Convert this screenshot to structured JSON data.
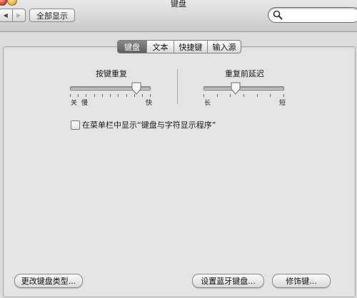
{
  "window": {
    "title": "键盘"
  },
  "toolbar": {
    "back_glyph": "◀",
    "forward_glyph": "▶",
    "show_all_label": "全部显示",
    "search": {
      "value": "",
      "placeholder": ""
    }
  },
  "tabs": [
    {
      "label": "键盘",
      "selected": true
    },
    {
      "label": "文本",
      "selected": false
    },
    {
      "label": "快捷键",
      "selected": false
    },
    {
      "label": "输入源",
      "selected": false
    }
  ],
  "key_repeat": {
    "title": "按键重复",
    "min_labels": [
      "关",
      "慢"
    ],
    "max_label": "快",
    "value_fraction": 0.82
  },
  "repeat_delay": {
    "title": "重复前延迟",
    "min_label": "长",
    "max_label": "短",
    "value_fraction": 0.4
  },
  "show_viewer": {
    "label": "在菜单栏中显示“键盘与字符显示程序”",
    "checked": false
  },
  "buttons": {
    "change_type": "更改键盘类型...",
    "bluetooth": "设置蓝牙键盘...",
    "modifier": "修饰键..."
  },
  "icons": {
    "search": "magnifier-icon"
  }
}
